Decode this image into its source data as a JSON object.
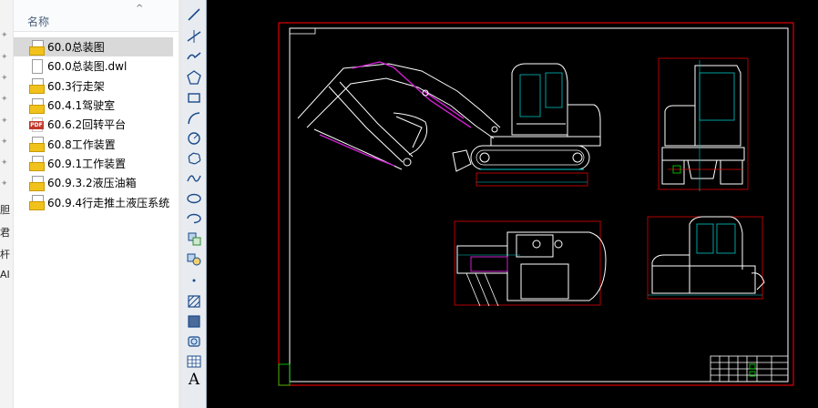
{
  "explorer": {
    "column_header": "名称",
    "sort_caret": "^",
    "left_fragments": [
      "胆",
      "君",
      "杆",
      "AI"
    ],
    "files": [
      {
        "name": "60.0总装图",
        "type": "dwg",
        "selected": true
      },
      {
        "name": "60.0总装图.dwl",
        "type": "dwl",
        "selected": false
      },
      {
        "name": "60.3行走架",
        "type": "dwg",
        "selected": false
      },
      {
        "name": "60.4.1驾驶室",
        "type": "dwg",
        "selected": false
      },
      {
        "name": "60.6.2回转平台",
        "type": "pdf",
        "selected": false
      },
      {
        "name": "60.8工作装置",
        "type": "dwg",
        "selected": false
      },
      {
        "name": "60.9.1工作装置",
        "type": "dwg",
        "selected": false
      },
      {
        "name": "60.9.3.2液压油箱",
        "type": "dwg",
        "selected": false
      },
      {
        "name": "60.9.4行走推土液压系统",
        "type": "dwg",
        "selected": false
      }
    ]
  },
  "toolbar": {
    "tools": [
      "line-tool",
      "xline-tool",
      "polyline-tool",
      "polygon-tool",
      "rectangle-tool",
      "arc-tool",
      "circle-tool",
      "revcloud-tool",
      "spline-tool",
      "ellipse-tool",
      "ellipse-arc-tool",
      "insert-block-tool",
      "make-block-tool",
      "point-tool",
      "hatch-tool",
      "gradient-tool",
      "region-tool",
      "table-tool",
      "mtext-tool"
    ],
    "text_tool_glyph": "A"
  },
  "colors": {
    "frame": "#e00000",
    "geometry": "#ffffff",
    "hydraulics": "#d020d0",
    "dimensions": "#00c8c8",
    "accent": "#00e000"
  }
}
